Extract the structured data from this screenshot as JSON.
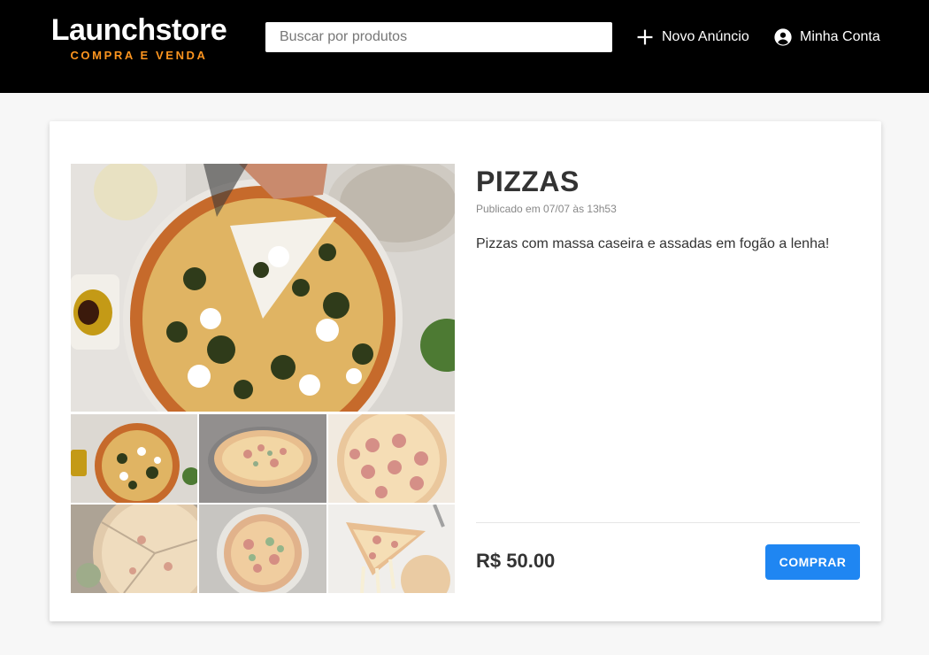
{
  "header": {
    "logo_title": "Launchstore",
    "logo_subtitle": "COMPRA E VENDA",
    "search_placeholder": "Buscar por produtos",
    "new_ad_label": "Novo Anúncio",
    "new_ad_icon": "plus-icon",
    "account_label": "Minha Conta",
    "account_icon": "account-circle-icon"
  },
  "product": {
    "title": "PIZZAS",
    "published": "Publicado em 07/07 às 13h53",
    "description": "Pizzas com massa caseira e assadas em fogão a lenha!",
    "price": "R$ 50.00",
    "buy_label": "COMPRAR"
  },
  "gallery": {
    "thumbnails": [
      {
        "subject": "pizza with mozzarella and spinach",
        "active": true
      },
      {
        "subject": "pizza in iron pan",
        "active": false
      },
      {
        "subject": "pepperoni pizza",
        "active": false
      },
      {
        "subject": "sliced pizza with herbs",
        "active": false
      },
      {
        "subject": "margherita pizza on table",
        "active": false
      },
      {
        "subject": "pizza slice with melted cheese",
        "active": false
      }
    ]
  },
  "colors": {
    "header_bg": "#000000",
    "accent_orange": "#fd951f",
    "button_blue": "#1f86f2",
    "page_bg": "#f7f7f7"
  }
}
